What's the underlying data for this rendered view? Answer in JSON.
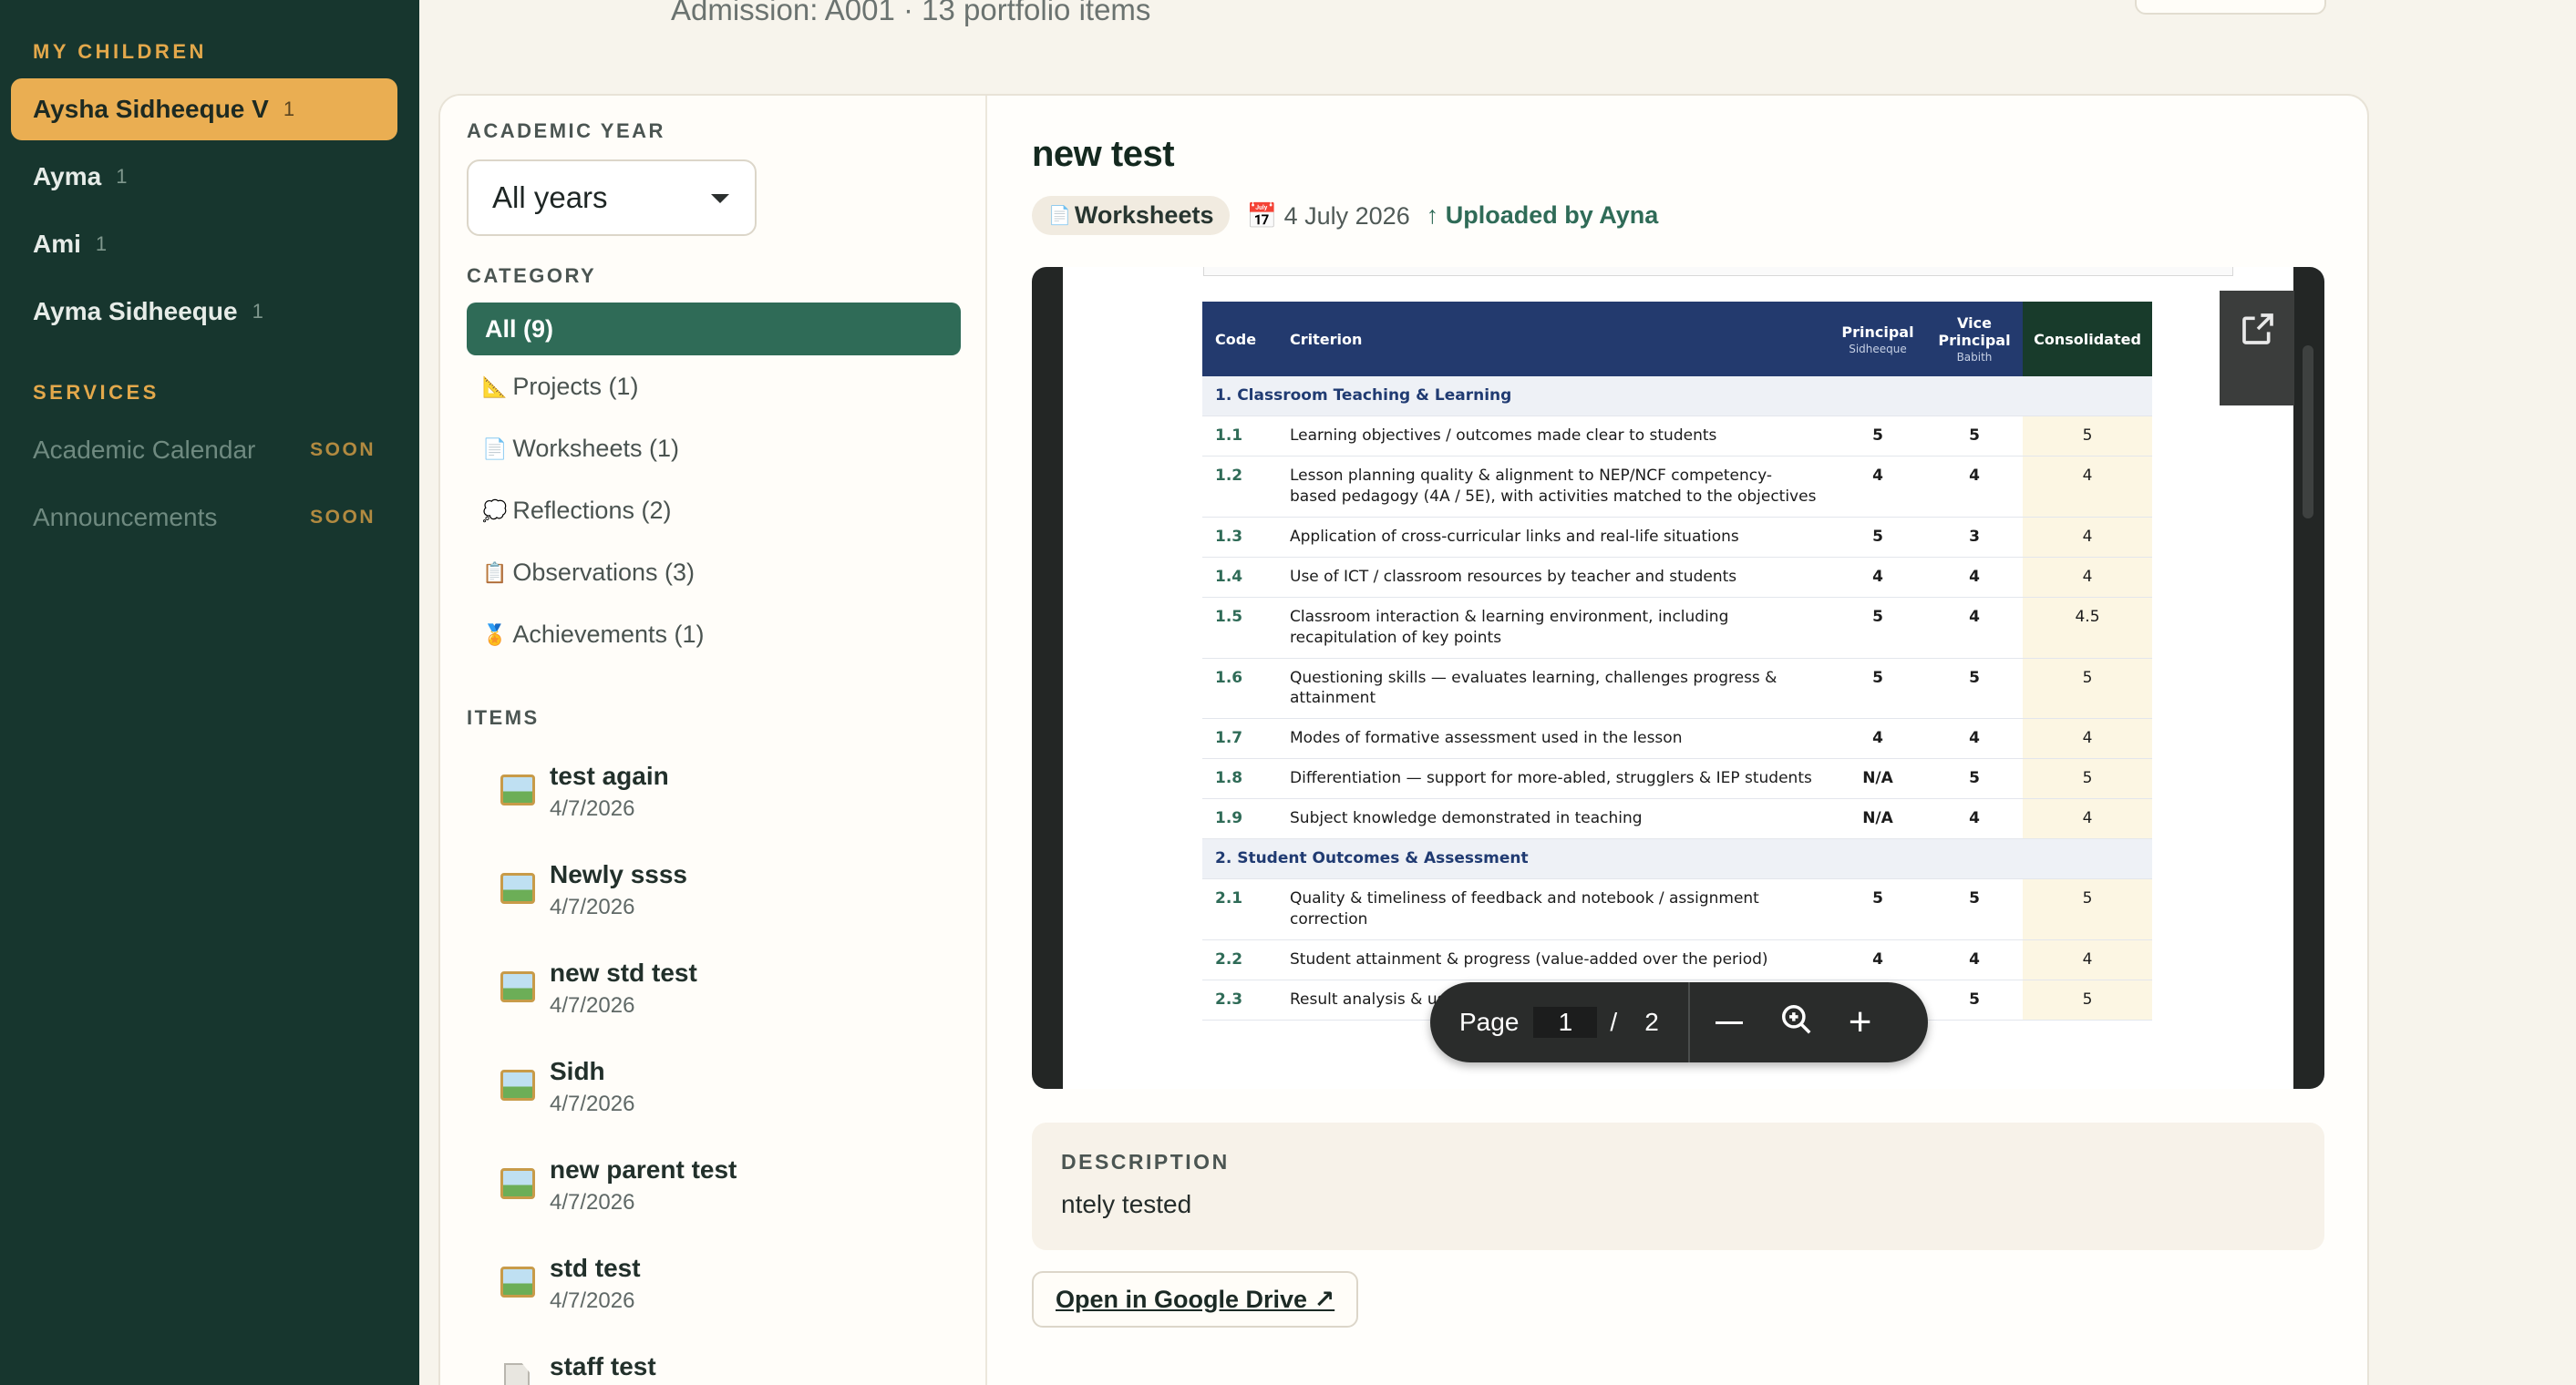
{
  "sidebar": {
    "my_children_heading": "MY CHILDREN",
    "children": [
      {
        "name": "Aysha Sidheeque V",
        "count": "1"
      },
      {
        "name": "Ayma",
        "count": "1"
      },
      {
        "name": "Ami",
        "count": "1"
      },
      {
        "name": "Ayma Sidheeque",
        "count": "1"
      }
    ],
    "services_heading": "SERVICES",
    "services": [
      {
        "label": "Academic Calendar",
        "badge": "SOON"
      },
      {
        "label": "Announcements",
        "badge": "SOON"
      }
    ]
  },
  "header": {
    "admission": "Admission: A001 · 13 portfolio items"
  },
  "filters": {
    "academic_year_label": "ACADEMIC YEAR",
    "year_value": "All years",
    "category_label": "CATEGORY",
    "categories": [
      {
        "icon": "",
        "label": "All (9)"
      },
      {
        "icon": "📐",
        "label": "Projects (1)"
      },
      {
        "icon": "📄",
        "label": "Worksheets (1)"
      },
      {
        "icon": "💭",
        "label": "Reflections (2)"
      },
      {
        "icon": "📋",
        "label": "Observations (3)"
      },
      {
        "icon": "🏅",
        "label": "Achievements (1)"
      }
    ],
    "items_label": "ITEMS",
    "items": [
      {
        "name": "test again",
        "date": "4/7/2026",
        "kind": "image"
      },
      {
        "name": "Newly ssss",
        "date": "4/7/2026",
        "kind": "image"
      },
      {
        "name": "new std test",
        "date": "4/7/2026",
        "kind": "image"
      },
      {
        "name": "Sidh",
        "date": "4/7/2026",
        "kind": "image"
      },
      {
        "name": "new parent test",
        "date": "4/7/2026",
        "kind": "image"
      },
      {
        "name": "std test",
        "date": "4/7/2026",
        "kind": "image"
      },
      {
        "name": "staff test",
        "date": "",
        "kind": "document"
      }
    ]
  },
  "detail": {
    "title": "new test",
    "category_icon": "📄",
    "category": "Worksheets",
    "date_icon": "📅",
    "date": "4 July 2026",
    "uploaded": "↑ Uploaded by Ayna",
    "description_label": "DESCRIPTION",
    "description": "ntely tested",
    "drive_link": "Open in Google Drive ↗"
  },
  "viewer": {
    "page_label": "Page",
    "page_current": "1",
    "page_separator": "/",
    "page_total": "2",
    "table": {
      "headers": {
        "code": "Code",
        "criterion": "Criterion",
        "principal": "Principal",
        "principal_sub": "Sidheeque",
        "vice_line1": "Vice",
        "vice_line2": "Principal",
        "vice_sub": "Babith",
        "consolidated": "Consolidated"
      },
      "rows": [
        {
          "section": "1. Classroom Teaching & Learning"
        },
        {
          "code": "1.1",
          "criterion": "Learning objectives / outcomes made clear to students",
          "p": "5",
          "v": "5",
          "c": "5"
        },
        {
          "code": "1.2",
          "criterion": "Lesson planning quality & alignment to NEP/NCF competency-based pedagogy (4A / 5E), with activities matched to the objectives",
          "p": "4",
          "v": "4",
          "c": "4"
        },
        {
          "code": "1.3",
          "criterion": "Application of cross-curricular links and real-life situations",
          "p": "5",
          "v": "3",
          "c": "4"
        },
        {
          "code": "1.4",
          "criterion": "Use of ICT / classroom resources by teacher and students",
          "p": "4",
          "v": "4",
          "c": "4"
        },
        {
          "code": "1.5",
          "criterion": "Classroom interaction & learning environment, including recapitulation of key points",
          "p": "5",
          "v": "4",
          "c": "4.5"
        },
        {
          "code": "1.6",
          "criterion": "Questioning skills — evaluates learning, challenges progress & attainment",
          "p": "5",
          "v": "5",
          "c": "5"
        },
        {
          "code": "1.7",
          "criterion": "Modes of formative assessment used in the lesson",
          "p": "4",
          "v": "4",
          "c": "4"
        },
        {
          "code": "1.8",
          "criterion": "Differentiation — support for more-abled, strugglers & IEP students",
          "p": "N/A",
          "v": "5",
          "c": "5"
        },
        {
          "code": "1.9",
          "criterion": "Subject knowledge demonstrated in teaching",
          "p": "N/A",
          "v": "4",
          "c": "4"
        },
        {
          "section": "2. Student Outcomes & Assessment"
        },
        {
          "code": "2.1",
          "criterion": "Quality & timeliness of feedback and notebook / assignment correction",
          "p": "5",
          "v": "5",
          "c": "5"
        },
        {
          "code": "2.2",
          "criterion": "Student attainment & progress (value-added over the period)",
          "p": "4",
          "v": "4",
          "c": "4"
        },
        {
          "code": "2.3",
          "criterion": "Result analysis & use of data to improve learning",
          "p": "5",
          "v": "5",
          "c": "5"
        }
      ]
    }
  }
}
